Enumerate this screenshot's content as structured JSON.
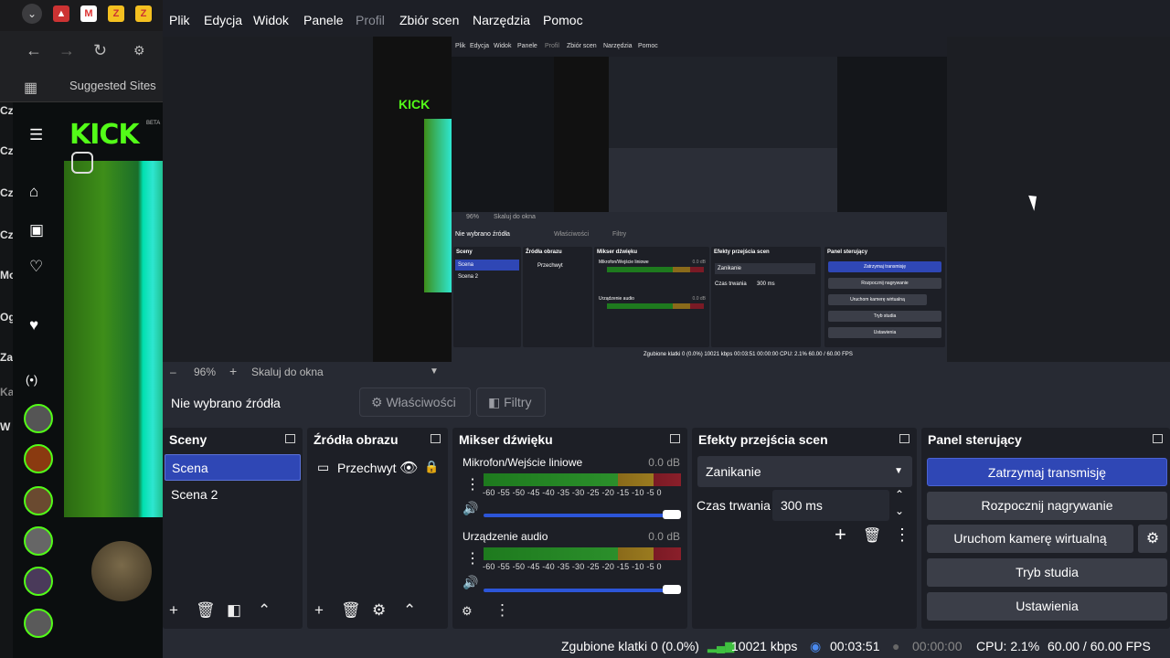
{
  "browser": {
    "nav_back_icon": "arrow-left-icon",
    "bookmark_label": "Suggested Sites",
    "kick_logo": "KICK",
    "kick_beta": "BETA",
    "left_letters": [
      "Cz",
      "Cz",
      "Cz",
      "Cz",
      "Mo",
      "Og",
      "Za",
      "Ka",
      "W"
    ]
  },
  "nested": {
    "menu": [
      "Plik",
      "Edycja",
      "Widok",
      "Panele",
      "Profil",
      "Zbiór scen",
      "Narzędzia",
      "Pomoc"
    ],
    "zoom": "96%",
    "scale_label": "Skaluj do okna",
    "no_source": "Nie wybrano źródła",
    "properties": "Właściwości",
    "filters": "Filtry",
    "scenes_title": "Sceny",
    "scene1": "Scena",
    "scene2": "Scena 2",
    "sources_title": "Źródła obrazu",
    "source1": "Przechwyt",
    "mixer_title": "Mikser dźwięku",
    "mic": "Mikrofon/Wejście liniowe",
    "audio": "Urządzenie audio",
    "db": "0.0 dB",
    "transitions_title": "Efekty przejścia scen",
    "fade": "Zanikanie",
    "duration_label": "Czas trwania",
    "duration": "300 ms",
    "controls_title": "Panel sterujący",
    "stop_stream": "Zatrzymaj transmisję",
    "start_rec": "Rozpocznij nagrywanie",
    "vcam": "Uruchom kamerę wirtualną",
    "studio": "Tryb studia",
    "settings": "Ustawienia",
    "status": "Zgubione klatki 0 (0.0%)   10021 kbps   00:03:51   00:00:00   CPU: 2.1%   60.00 / 60.00 FPS"
  },
  "menu": {
    "plik": "Plik",
    "edycja": "Edycja",
    "widok": "Widok",
    "panele": "Panele",
    "profil": "Profil",
    "zbior": "Zbiór scen",
    "narzedzia": "Narzędzia",
    "pomoc": "Pomoc"
  },
  "zoombar": {
    "minus": "–",
    "zoom": "96%",
    "plus": "+",
    "scale": "Skaluj do okna"
  },
  "source_toolbar": {
    "no_source": "Nie wybrano źródła",
    "properties": "Właściwości",
    "filters": "Filtry"
  },
  "scenes": {
    "title": "Sceny",
    "items": [
      "Scena",
      "Scena 2"
    ],
    "selected_index": 0
  },
  "sources": {
    "title": "Źródła obrazu",
    "items": [
      {
        "label": "Przechwyt",
        "visible": true,
        "locked": true
      }
    ]
  },
  "mixer": {
    "title": "Mikser dźwięku",
    "channels": [
      {
        "name": "Mikrofon/Wejście liniowe",
        "db": "0.0 dB",
        "volume": 1.0
      },
      {
        "name": "Urządzenie audio",
        "db": "0.0 dB",
        "volume": 1.0
      }
    ],
    "scale": "-60 -55 -50 -45 -40 -35 -30 -25 -20 -15 -10  -5   0"
  },
  "transitions": {
    "title": "Efekty przejścia scen",
    "selected": "Zanikanie",
    "duration_label": "Czas trwania",
    "duration": "300 ms"
  },
  "controls": {
    "title": "Panel sterujący",
    "stop_stream": "Zatrzymaj transmisję",
    "start_recording": "Rozpocznij nagrywanie",
    "virtual_cam": "Uruchom kamerę wirtualną",
    "studio_mode": "Tryb studia",
    "settings": "Ustawienia"
  },
  "status": {
    "dropped": "Zgubione klatki 0 (0.0%)",
    "bitrate": "10021 kbps",
    "stream_time": "00:03:51",
    "rec_time": "00:00:00",
    "cpu": "CPU: 2.1%",
    "fps": "60.00 / 60.00 FPS"
  },
  "colors": {
    "accent": "#2f47b5",
    "kick_green": "#53fc18",
    "bitrate_green": "#3fbf3f"
  }
}
